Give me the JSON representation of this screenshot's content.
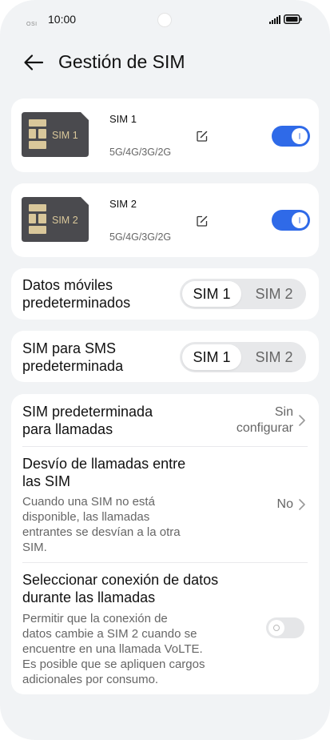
{
  "status_bar": {
    "time": "10:00",
    "tiny_label": "OSI"
  },
  "header": {
    "title": "Gestión de SIM"
  },
  "sims": [
    {
      "card_label": "SIM 1",
      "name": "SIM 1",
      "networks": "5G/4G/3G/2G",
      "enabled": true
    },
    {
      "card_label": "SIM 2",
      "name": "SIM 2",
      "networks": "5G/4G/3G/2G",
      "enabled": true
    }
  ],
  "default_data": {
    "label_line1": "Datos móviles",
    "label_line2": "predeterminados",
    "options": [
      "SIM 1",
      "SIM 2"
    ],
    "selected": "SIM 1"
  },
  "default_sms": {
    "label_line1": "SIM para SMS",
    "label_line2": "predeterminada",
    "options": [
      "SIM 1",
      "SIM 2"
    ],
    "selected": "SIM 1"
  },
  "calls_section": {
    "default_call": {
      "label_line1": "SIM predeterminada",
      "label_line2": "para llamadas",
      "value_line1": "Sin",
      "value_line2": "configurar"
    },
    "call_forwarding": {
      "title_line1": "Desvío de llamadas entre",
      "title_line2": "las SIM",
      "desc_line1": "Cuando una SIM no está",
      "desc_line2": "disponible, las llamadas",
      "desc_line3": "entrantes se desvían a la otra",
      "desc_line4": "SIM.",
      "value": "No"
    },
    "data_during_calls": {
      "title_line1": "Seleccionar conexión de datos",
      "title_line2": "durante las llamadas",
      "desc_line1": "Permitir que la conexión de",
      "desc_line2": "datos cambie a SIM 2 cuando se",
      "desc_line3": "encuentre en una llamada VoLTE.",
      "desc_line4": "Es posible que se apliquen cargos",
      "desc_line5": "adicionales por consumo.",
      "enabled": false
    }
  },
  "colors": {
    "accent": "#2f6ae8",
    "background": "#f1f3f5",
    "card": "#ffffff",
    "sim_card_body": "#4a4a4e",
    "sim_chip": "#d9c79a"
  },
  "icons": {
    "back": "arrow-left-icon",
    "edit": "edit-icon",
    "chevron": "chevron-right-icon",
    "signal": "signal-icon",
    "battery": "battery-icon"
  }
}
